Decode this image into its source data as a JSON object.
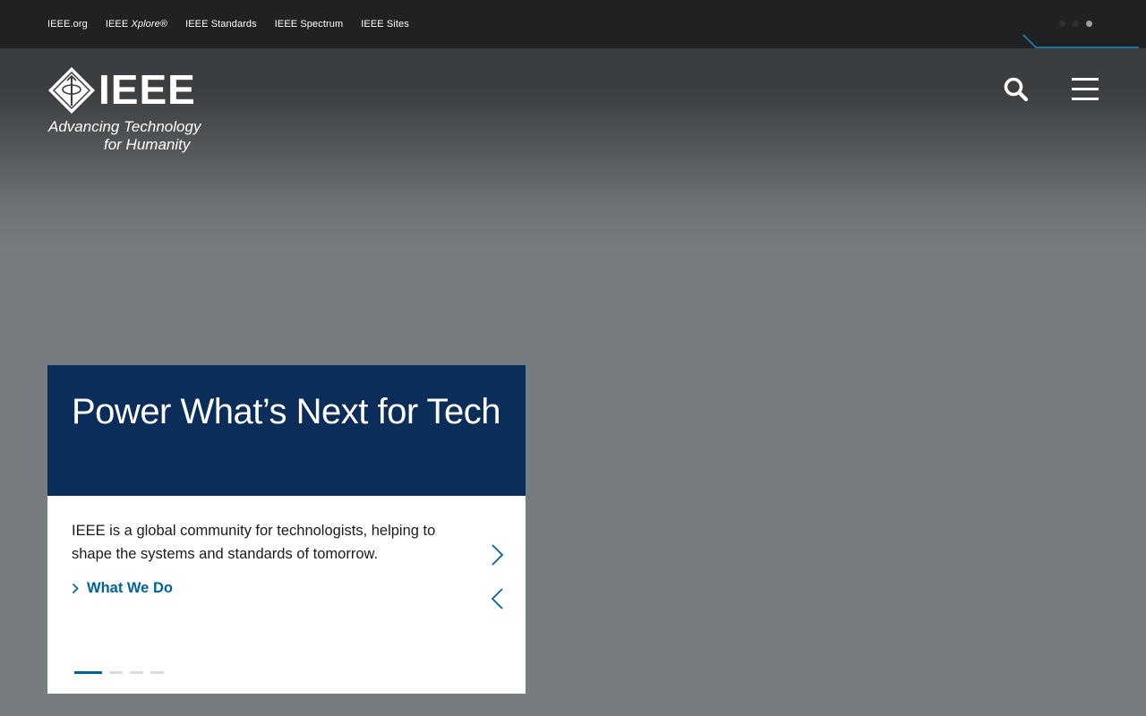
{
  "top_nav": {
    "items": [
      {
        "prefix": "IEEE.org",
        "em": "",
        "suffix": ""
      },
      {
        "prefix": "IEEE ",
        "em": "Xplore",
        "suffix": "®"
      },
      {
        "prefix": "IEEE Standards",
        "em": "",
        "suffix": ""
      },
      {
        "prefix": "IEEE Spectrum",
        "em": "",
        "suffix": ""
      },
      {
        "prefix": "IEEE Sites",
        "em": "",
        "suffix": ""
      }
    ]
  },
  "logo": {
    "wordmark": "IEEE",
    "tagline_line1": "Advancing Technology",
    "tagline_line2": "for Humanity"
  },
  "header": {
    "search_icon": "search-icon",
    "menu_icon": "hamburger-menu-icon"
  },
  "hero_card": {
    "title": "Power What’s Next for Tech",
    "description": "IEEE is a global community for technologists, helping to shape the systems and standards of tomorrow.",
    "link_label": "What We Do",
    "next_icon": "chevron-right-icon",
    "prev_icon": "chevron-left-icon",
    "slide_count": 4,
    "active_slide": 1
  },
  "colors": {
    "top_bar": "#1f2122",
    "card_header": "#0b2d5a",
    "link_blue": "#00629b",
    "hero_gray": "#777c80"
  }
}
